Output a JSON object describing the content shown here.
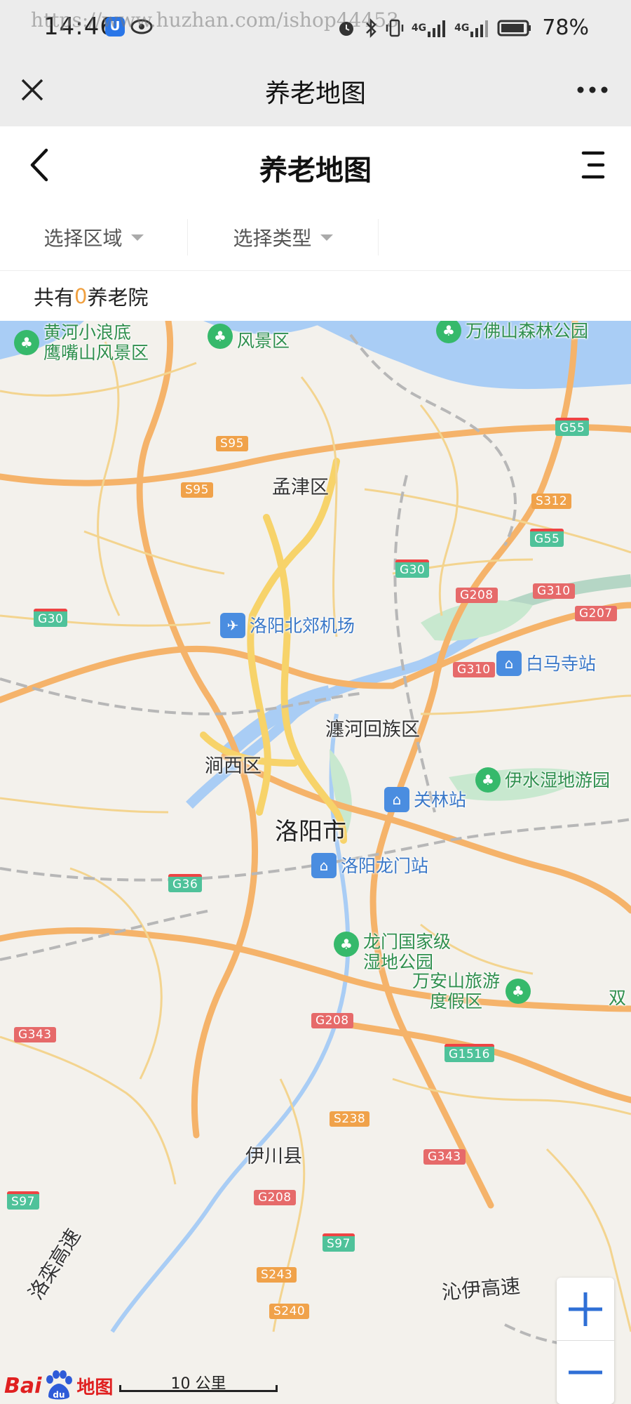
{
  "status_bar": {
    "time": "14:46",
    "watermark": "https://www.huzhan.com/ishop44453",
    "battery": "78%",
    "network_1": "4G",
    "network_2": "4G"
  },
  "wechat_bar": {
    "title": "养老地图"
  },
  "header": {
    "title": "养老地图"
  },
  "filters": {
    "area_label": "选择区域",
    "type_label": "选择类型"
  },
  "count": {
    "prefix": "共有",
    "number": "0",
    "suffix": "养老院"
  },
  "map": {
    "city": "洛阳市",
    "districts": [
      "孟津区",
      "瀍河回族区",
      "涧西区",
      "伊川县"
    ],
    "pois": {
      "yellow_river": "黄河小浪底\n鹰嘴山风景区",
      "fengjing": "风景区",
      "wanfo": "万佛山森林公园",
      "airport": "洛阳北郊机场",
      "baimasi": "白马寺站",
      "yishui": "伊水湿地游园",
      "guanlin": "关林站",
      "longmen_station": "洛阳龙门站",
      "longmen_park": "龙门国家级\n湿地公园",
      "wananshan": "万安山旅游\n度假区",
      "shuang": "双"
    },
    "highways": {
      "qinyi": "沁伊高速",
      "luoluan": "洛栾高速"
    },
    "shields": {
      "s95a": "S95",
      "s95b": "S95",
      "g55a": "G55",
      "s312": "S312",
      "g55b": "G55",
      "g30a": "G30",
      "g30b": "G30",
      "g208a": "G208",
      "g310a": "G310",
      "g207": "G207",
      "g310b": "G310",
      "g36": "G36",
      "g208b": "G208",
      "g343a": "G343",
      "g1516": "G1516",
      "s238": "S238",
      "g343b": "G343",
      "s97a": "S97",
      "g208c": "G208",
      "s97b": "S97",
      "s243": "S243",
      "s240": "S240"
    },
    "scale": "10 公里",
    "logo_text": "Bai",
    "logo_du": "du",
    "logo_map": "地图"
  },
  "colors": {
    "accent_count": "#f0a040",
    "map_bg": "#f3f1ec",
    "water": "#a9cdf5",
    "road_major": "#f5b36a",
    "road_urban": "#f7d36a"
  }
}
